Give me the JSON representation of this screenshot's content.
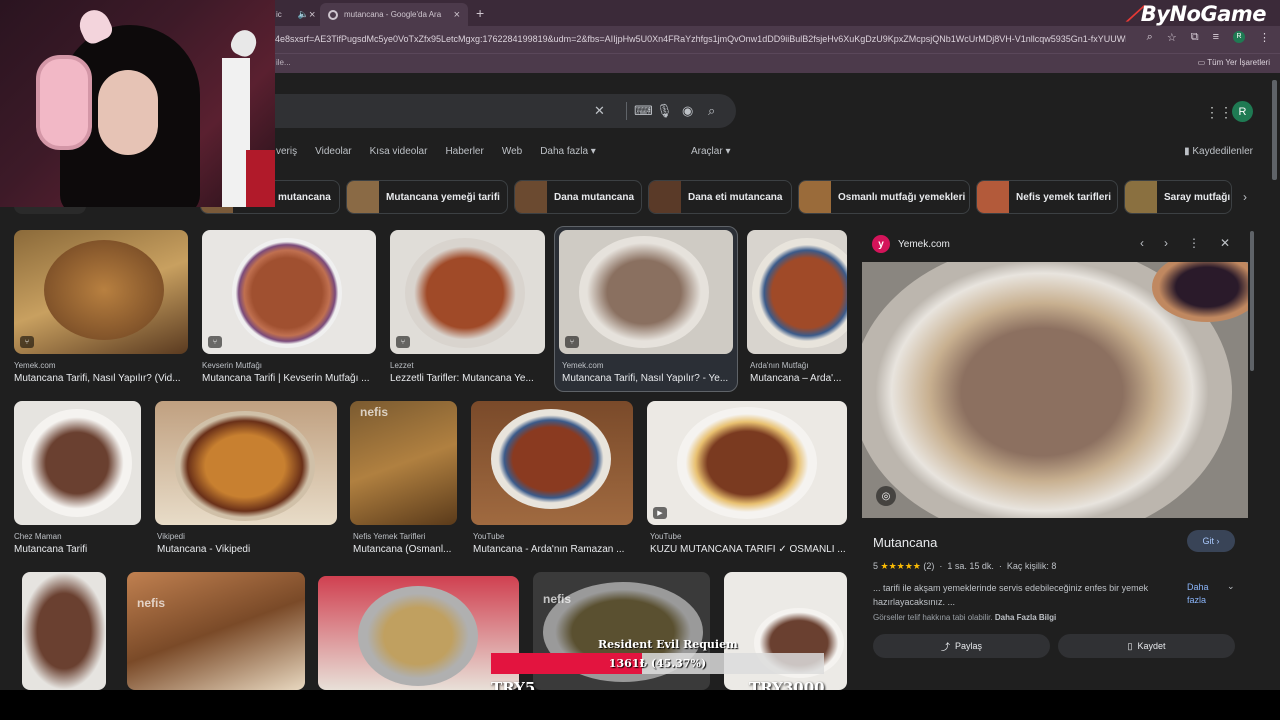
{
  "browser": {
    "inactive_tab_fragment": "ic",
    "active_tab": {
      "title": "mutancana - Google'da Ara"
    },
    "url": "b4e8sxsrf=AE3TifPugsdMc5ye0VoTxZfx95LetcMgxg:1762284199819&udm=2&fbs=AIIjpHw5U0Xn4FRaYzhfgs1jmQvOnw1dDD9iiBulB2fsjeHv6XuKgDzU9KpxZMcpsjQNb1WcUrMDj8VH-V1nllcqw5935Gn1-fxYUUWljmnUG...",
    "bookmarks_left": "ile...",
    "bookmarks_right": "Tüm Yer İşaretleri"
  },
  "streamer": {
    "brand": "ByNoGame"
  },
  "google": {
    "nav_tabs": [
      "veriş",
      "Videolar",
      "Kısa videolar",
      "Haberler",
      "Web",
      "Daha fazla ▾"
    ],
    "tools": "Araçlar ▾",
    "saved": "Kaydedilenler",
    "avatar": "R",
    "chips": [
      "mutancana",
      "Mutancana yemeği tarifi",
      "Dana mutancana",
      "Dana eti mutancana",
      "Osmanlı mutfağı yemekleri",
      "Nefis yemek tarifleri",
      "Saray mutfağı"
    ]
  },
  "results": [
    {
      "source": "Yemek.com",
      "title": "Mutancana Tarifi, Nasıl Yapılır? (Vid..."
    },
    {
      "source": "Kevserin Mutfağı",
      "title": "Mutancana Tarifi | Kevserin Mutfağı ..."
    },
    {
      "source": "Lezzet",
      "title": "Lezzetli Tarifler: Mutancana Ye..."
    },
    {
      "source": "Yemek.com",
      "title": "Mutancana Tarifi, Nasıl Yapılır? - Ye..."
    },
    {
      "source": "Arda'nın Mutfağı",
      "title": "Mutancana – Arda'..."
    },
    {
      "source": "Chez Maman",
      "title": "Mutancana Tarifi"
    },
    {
      "source": "Vikipedi",
      "title": "Mutancana - Vikipedi"
    },
    {
      "source": "Nefis Yemek Tarifleri",
      "title": "Mutancana (Osmanl..."
    },
    {
      "source": "YouTube",
      "title": "Mutancana - Arda'nın Ramazan ..."
    },
    {
      "source": "YouTube",
      "title": "KUZU MUTANCANA TARİFİ ✓ OSMANLI ..."
    }
  ],
  "panel": {
    "favicon_letter": "y",
    "source": "Yemek.com",
    "title": "Mutancana",
    "go_label": "Git ›",
    "rating": "5",
    "stars": "★★★★★",
    "reviews": "(2)",
    "time": "1 sa. 15 dk.",
    "servings": "Kaç kişilik: 8",
    "description": "... tarifi ile akşam yemeklerinde servis edebileceğiniz enfes bir yemek hazırlayacaksınız. ...",
    "more": "Daha fazla",
    "copyright": "Görseller telif hakkına tabi olabilir.",
    "copyright_link": "Daha Fazla Bilgi",
    "share": "Paylaş",
    "save": "Kaydet"
  },
  "overlay": {
    "game": "Resident Evil Requiem",
    "progress_text": "1361₺ (45.37%)",
    "progress_fraction": 0.4537,
    "goal_min": "TRY5",
    "goal_max": "TRY3000",
    "fill_color": "#e3143f"
  }
}
